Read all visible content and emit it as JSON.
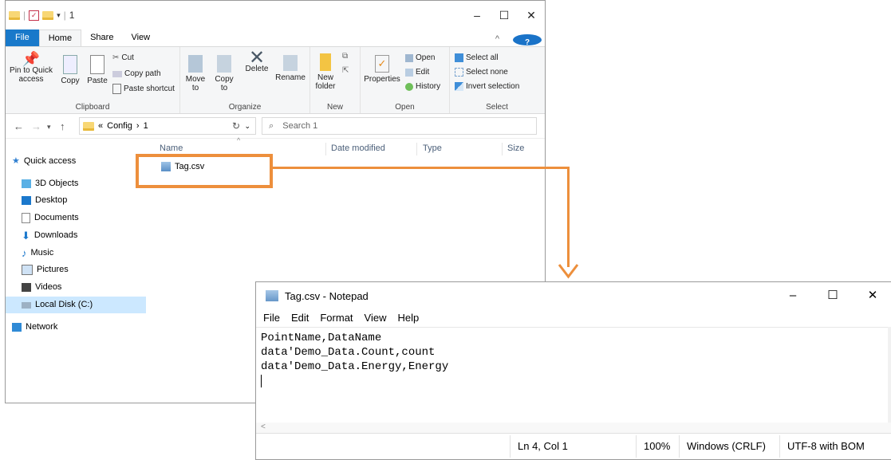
{
  "explorer": {
    "title": "1",
    "ribbon_tabs": [
      "File",
      "Home",
      "Share",
      "View"
    ],
    "clipboard": {
      "pin": "Pin to Quick access",
      "copy": "Copy",
      "paste": "Paste",
      "cut": "Cut",
      "copy_path": "Copy path",
      "paste_shortcut": "Paste shortcut",
      "label": "Clipboard"
    },
    "organize": {
      "move_to": "Move to",
      "copy_to": "Copy to",
      "delete": "Delete",
      "rename": "Rename",
      "label": "Organize"
    },
    "new": {
      "new_folder": "New folder",
      "label": "New"
    },
    "open": {
      "properties": "Properties",
      "open": "Open",
      "edit": "Edit",
      "history": "History",
      "label": "Open"
    },
    "select": {
      "select_all": "Select all",
      "select_none": "Select none",
      "invert": "Invert selection",
      "label": "Select"
    },
    "address": {
      "prefix": "«",
      "crumb1": "Config",
      "crumb2": "1",
      "search_placeholder": "Search 1"
    },
    "nav": [
      {
        "label": "Quick access",
        "icon": "star-icon"
      },
      {
        "label": "3D Objects",
        "icon": "cube-icon"
      },
      {
        "label": "Desktop",
        "icon": "desktop-icon"
      },
      {
        "label": "Documents",
        "icon": "documents-icon"
      },
      {
        "label": "Downloads",
        "icon": "download-icon"
      },
      {
        "label": "Music",
        "icon": "music-icon"
      },
      {
        "label": "Pictures",
        "icon": "pictures-icon"
      },
      {
        "label": "Videos",
        "icon": "videos-icon"
      },
      {
        "label": "Local Disk (C:)",
        "icon": "disk-icon"
      },
      {
        "label": "Network",
        "icon": "network-icon"
      }
    ],
    "columns": {
      "name": "Name",
      "date": "Date modified",
      "type": "Type",
      "size": "Size"
    },
    "file": {
      "name": "Tag.csv"
    }
  },
  "notepad": {
    "title": "Tag.csv - Notepad",
    "menu": [
      "File",
      "Edit",
      "Format",
      "View",
      "Help"
    ],
    "lines": [
      "PointName,DataName",
      "data'Demo_Data.Count,count",
      "data'Demo_Data.Energy,Energy"
    ],
    "status": {
      "position": "Ln 4, Col 1",
      "zoom": "100%",
      "line_ending": "Windows (CRLF)",
      "encoding": "UTF-8 with BOM"
    }
  },
  "colors": {
    "highlight": "#ed8f3c",
    "accent": "#1979ca",
    "selection": "#cce8ff"
  }
}
